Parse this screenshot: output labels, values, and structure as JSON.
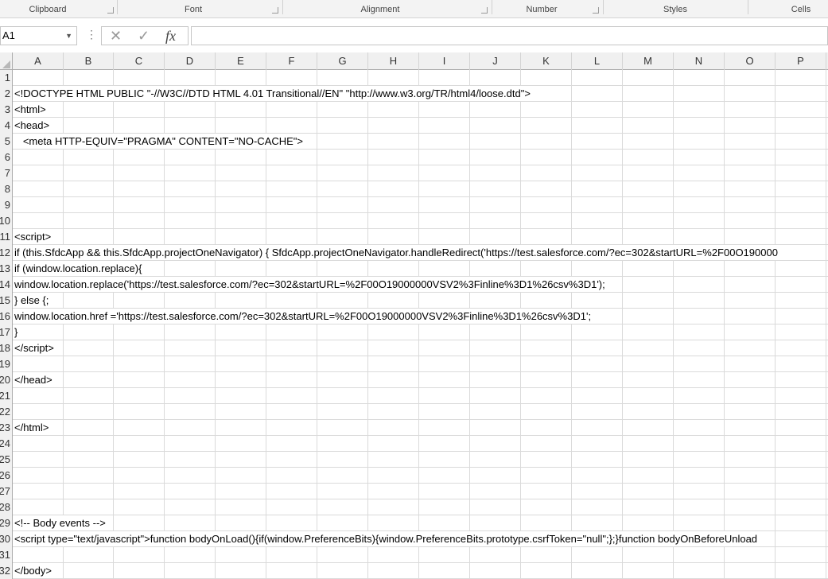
{
  "ribbon": {
    "groups": [
      "Clipboard",
      "Font",
      "Alignment",
      "Number",
      "Styles",
      "Cells"
    ]
  },
  "formula_bar": {
    "name_box": "A1",
    "cancel_icon": "✕",
    "enter_icon": "✓",
    "fx_label": "fx",
    "value": ""
  },
  "columns": [
    "A",
    "B",
    "C",
    "D",
    "E",
    "F",
    "G",
    "H",
    "I",
    "J",
    "K",
    "L",
    "M",
    "N",
    "O",
    "P"
  ],
  "rows": [
    {
      "n": "1",
      "text": ""
    },
    {
      "n": "2",
      "text": "<!DOCTYPE HTML PUBLIC \"-//W3C//DTD HTML 4.01 Transitional//EN\" \"http://www.w3.org/TR/html4/loose.dtd\">"
    },
    {
      "n": "3",
      "text": "<html>"
    },
    {
      "n": "4",
      "text": "<head>"
    },
    {
      "n": "5",
      "text": "   <meta HTTP-EQUIV=\"PRAGMA\" CONTENT=\"NO-CACHE\">"
    },
    {
      "n": "6",
      "text": ""
    },
    {
      "n": "7",
      "text": ""
    },
    {
      "n": "8",
      "text": ""
    },
    {
      "n": "9",
      "text": ""
    },
    {
      "n": "10",
      "text": ""
    },
    {
      "n": "11",
      "text": "<script>"
    },
    {
      "n": "12",
      "text": "if (this.SfdcApp && this.SfdcApp.projectOneNavigator) { SfdcApp.projectOneNavigator.handleRedirect('https://test.salesforce.com/?ec=302&startURL=%2F00O190000"
    },
    {
      "n": "13",
      "text": "if (window.location.replace){"
    },
    {
      "n": "14",
      "text": "window.location.replace('https://test.salesforce.com/?ec=302&startURL=%2F00O19000000VSV2%3Finline%3D1%26csv%3D1');"
    },
    {
      "n": "15",
      "text": "} else {;"
    },
    {
      "n": "16",
      "text": "window.location.href ='https://test.salesforce.com/?ec=302&startURL=%2F00O19000000VSV2%3Finline%3D1%26csv%3D1';"
    },
    {
      "n": "17",
      "text": "}"
    },
    {
      "n": "18",
      "text": "</script>"
    },
    {
      "n": "19",
      "text": ""
    },
    {
      "n": "20",
      "text": "</head>"
    },
    {
      "n": "21",
      "text": ""
    },
    {
      "n": "22",
      "text": ""
    },
    {
      "n": "23",
      "text": "</html>"
    },
    {
      "n": "24",
      "text": ""
    },
    {
      "n": "25",
      "text": ""
    },
    {
      "n": "26",
      "text": ""
    },
    {
      "n": "27",
      "text": ""
    },
    {
      "n": "28",
      "text": ""
    },
    {
      "n": "29",
      "text": "<!-- Body events -->"
    },
    {
      "n": "30",
      "text": "<script type=\"text/javascript\">function bodyOnLoad(){if(window.PreferenceBits){window.PreferenceBits.prototype.csrfToken=\"null\";};}function bodyOnBeforeUnload"
    },
    {
      "n": "31",
      "text": ""
    },
    {
      "n": "32",
      "text": "</body>"
    }
  ]
}
